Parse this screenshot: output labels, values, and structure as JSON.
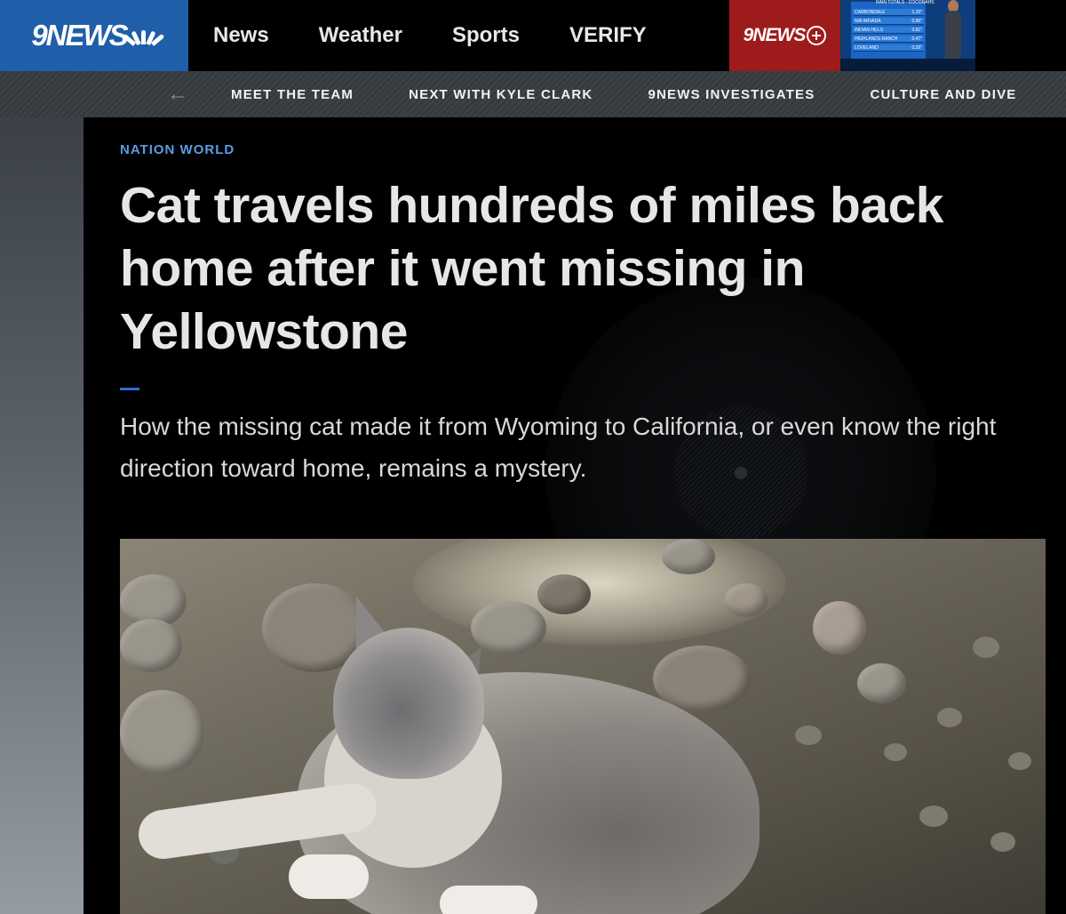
{
  "logo": {
    "text": "9NEWS"
  },
  "nav": {
    "items": [
      "News",
      "Weather",
      "Sports",
      "VERIFY"
    ],
    "plus_label": "9NEWS"
  },
  "thumbnail": {
    "title": "RAIN TOTALS - COCORAHS",
    "rows": [
      {
        "place": "CARBONDALE",
        "value": "1.10\""
      },
      {
        "place": "NW ARVADA",
        "value": "0.96\""
      },
      {
        "place": "INDIAN HILLS",
        "value": "0.81\""
      },
      {
        "place": "HIGHLANDS RANCH",
        "value": "0.47\""
      },
      {
        "place": "LOVELAND",
        "value": "0.39\""
      }
    ]
  },
  "subnav": {
    "back_icon": "arrow-left-icon",
    "items": [
      "MEET THE TEAM",
      "NEXT WITH KYLE CLARK",
      "9NEWS INVESTIGATES",
      "CULTURE AND DIVE"
    ]
  },
  "article": {
    "category": "NATION WORLD",
    "headline": "Cat travels hundreds of miles back home after it went missing in Yellowstone",
    "summary": "How the missing cat made it from Wyoming to California, or even know the right direction toward home, remains a mystery.",
    "accent_color": "#2a6fd0"
  },
  "colors": {
    "logo_bg": "#1f5ea8",
    "plus_bg": "#9e1b1b",
    "category": "#5b9be6"
  }
}
